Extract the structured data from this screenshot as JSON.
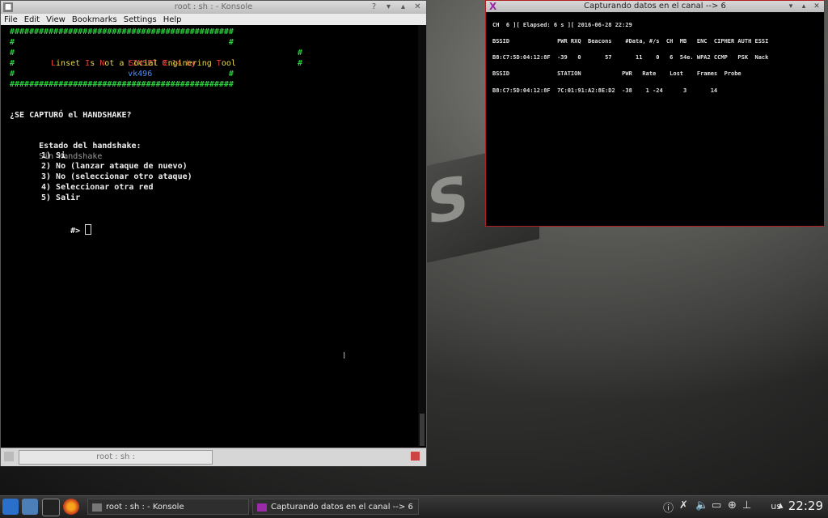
{
  "konsole": {
    "title": "root : sh : - Konsole",
    "menu": [
      "File",
      "Edit",
      "View",
      "Bookmarks",
      "Settings",
      "Help"
    ],
    "banner_hashes": "##############################################",
    "banner_side": "#                                            #",
    "banner_title": "LINSET 0.14 by",
    "banner_author": "vk496",
    "banner_sub": {
      "l1": "L",
      "r1": "inset ",
      "l2": "I",
      "r2": "s ",
      "l3": "N",
      "r3": "ot a ",
      "l4": "S",
      "r4": "ocial ",
      "l5": "E",
      "r5": "nginering ",
      "l6": "T",
      "r6": "ool"
    },
    "question": "¿SE CAPTURÓ el HANDSHAKE?",
    "status_label": "Estado del handshake:",
    "status_value": "Sin handshake",
    "options": [
      "1) Si",
      "2) No (lanzar ataque de nuevo)",
      "3) No (seleccionar otro ataque)",
      "4) Seleccionar otra red",
      "5) Salir"
    ],
    "prompt": "#>",
    "tab_label": "root : sh :"
  },
  "airodump": {
    "title": "Capturando datos en el canal --> 6",
    "status_line": "CH  6 ][ Elapsed: 6 s ][ 2016-06-28 22:29",
    "ap_header": "BSSID              PWR RXQ  Beacons    #Data, #/s  CH  MB   ENC  CIPHER AUTH ESSI",
    "ap_row": "B8:C7:5D:04:12:8F  -39   0       57       11    0   6  54e. WPA2 CCMP   PSK  Nack",
    "sta_header": "BSSID              STATION            PWR   Rate    Lost    Frames  Probe",
    "sta_row": "B8:C7:5D:04:12:8F  7C:01:91:A2:8E:D2  -38    1 -24      3       14"
  },
  "taskbar": {
    "task1": "root : sh : - Konsole",
    "task2": "Capturando datos en el canal --> 6",
    "keyboard": "us",
    "clock": "22:29"
  },
  "wallpaper_text": "S",
  "icons": {
    "kde": "kde-menu-icon",
    "files": "file-manager-icon",
    "terminal": "terminal-icon",
    "firefox": "firefox-icon"
  }
}
